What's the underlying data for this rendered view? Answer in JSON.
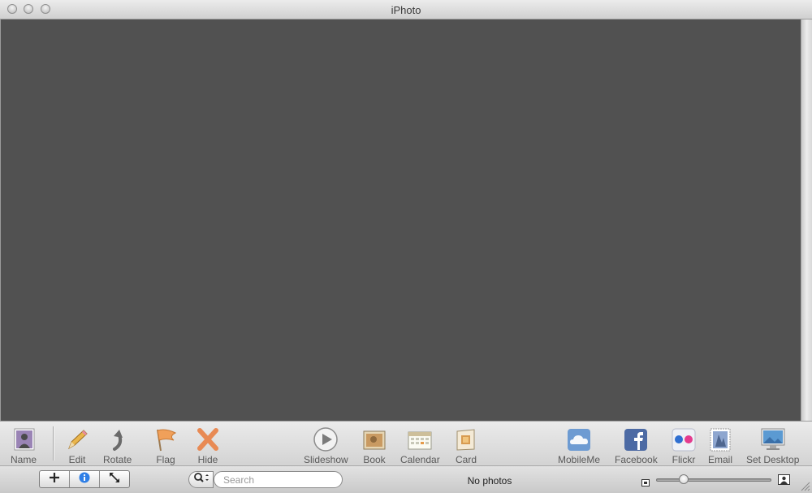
{
  "window": {
    "title": "iPhoto"
  },
  "toolbar": {
    "left": [
      {
        "label": "Name",
        "icon": "name-portrait-icon"
      },
      {
        "label": "Edit",
        "icon": "pencil-icon"
      },
      {
        "label": "Rotate",
        "icon": "rotate-arrow-icon"
      },
      {
        "label": "Flag",
        "icon": "flag-icon"
      },
      {
        "label": "Hide",
        "icon": "hide-x-icon"
      }
    ],
    "center": [
      {
        "label": "Slideshow",
        "icon": "play-icon"
      },
      {
        "label": "Book",
        "icon": "book-icon"
      },
      {
        "label": "Calendar",
        "icon": "calendar-icon"
      },
      {
        "label": "Card",
        "icon": "card-icon"
      }
    ],
    "right": [
      {
        "label": "MobileMe",
        "icon": "cloud-icon"
      },
      {
        "label": "Facebook",
        "icon": "facebook-icon"
      },
      {
        "label": "Flickr",
        "icon": "flickr-icon"
      },
      {
        "label": "Email",
        "icon": "stamp-icon"
      },
      {
        "label": "Set Desktop",
        "icon": "monitor-icon"
      }
    ]
  },
  "bottombar": {
    "buttons": [
      {
        "icon": "plus-icon"
      },
      {
        "icon": "info-icon"
      },
      {
        "icon": "fullscreen-icon"
      }
    ],
    "search": {
      "placeholder": "Search"
    },
    "status": "No photos"
  },
  "colors": {
    "content_background": "#515151",
    "toolbar_text": "#5a5a5a"
  }
}
